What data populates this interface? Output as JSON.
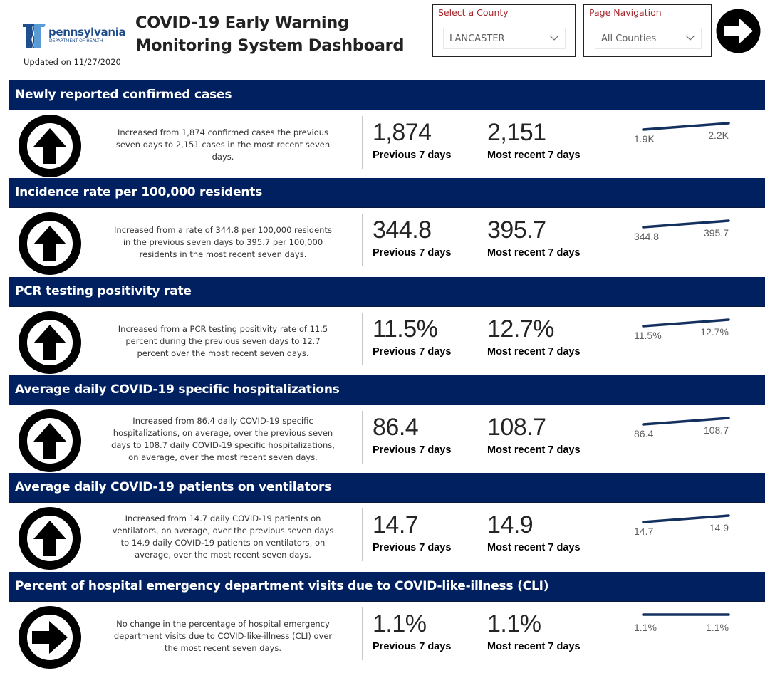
{
  "header": {
    "logo_name": "pennsylvania",
    "logo_sub": "DEPARTMENT OF HEALTH",
    "updated": "Updated on 11/27/2020",
    "title_line1": "COVID-19 Early Warning",
    "title_line2": "Monitoring System Dashboard"
  },
  "slicers": {
    "county": {
      "label": "Select a County",
      "value": "LANCASTER"
    },
    "navigation": {
      "label": "Page Navigation",
      "value": "All Counties"
    }
  },
  "nav_button": {
    "icon": "arrow-right-circle-icon"
  },
  "colors": {
    "header_bg": "#002060",
    "slicer_label": "#a4262c",
    "sparkline": "#14305e"
  },
  "sections": [
    {
      "title": "Newly reported confirmed cases",
      "trend": "up",
      "description": [
        "Increased from 1,874 confirmed cases the previous",
        "seven days to 2,151 cases in the most recent seven",
        "days."
      ],
      "previous_value": "1,874",
      "previous_label": "Previous 7 days",
      "recent_value": "2,151",
      "recent_label": "Most recent 7 days",
      "spark_start_label": "1.9K",
      "spark_end_label": "2.2K",
      "spark_values": [
        1874,
        2151
      ]
    },
    {
      "title": "Incidence rate per 100,000 residents",
      "trend": "up",
      "description": [
        "Increased from a rate of 344.8 per 100,000 residents",
        "in the previous seven days to 395.7 per 100,000",
        "residents in the most recent seven days."
      ],
      "previous_value": "344.8",
      "previous_label": "Previous 7 days",
      "recent_value": "395.7",
      "recent_label": "Most recent 7 days",
      "spark_start_label": "344.8",
      "spark_end_label": "395.7",
      "spark_values": [
        344.8,
        395.7
      ]
    },
    {
      "title": "PCR testing positivity rate",
      "trend": "up",
      "description": [
        "Increased from a PCR testing positivity rate of 11.5",
        "percent during the previous seven days to 12.7",
        "percent over the most recent seven days."
      ],
      "previous_value": "11.5%",
      "previous_label": "Previous 7 days",
      "recent_value": "12.7%",
      "recent_label": "Most recent 7 days",
      "spark_start_label": "11.5%",
      "spark_end_label": "12.7%",
      "spark_values": [
        11.5,
        12.7
      ]
    },
    {
      "title": "Average daily COVID-19 specific hospitalizations",
      "trend": "up",
      "description": [
        "Increased from 86.4 daily COVID-19 specific",
        "hospitalizations, on average, over the previous seven",
        "days to 108.7 daily COVID-19 specific hospitalizations,",
        "on average, over the most recent seven days."
      ],
      "previous_value": "86.4",
      "previous_label": "Previous 7 days",
      "recent_value": "108.7",
      "recent_label": "Most recent 7 days",
      "spark_start_label": "86.4",
      "spark_end_label": "108.7",
      "spark_values": [
        86.4,
        108.7
      ]
    },
    {
      "title": "Average daily COVID-19 patients on ventilators",
      "trend": "up",
      "description": [
        "Increased from 14.7 daily COVID-19 patients on",
        "ventilators, on average, over the previous seven days",
        "to 14.9 daily COVID-19 patients on ventilators, on",
        "average, over the most recent seven days."
      ],
      "previous_value": "14.7",
      "previous_label": "Previous 7 days",
      "recent_value": "14.9",
      "recent_label": "Most recent 7 days",
      "spark_start_label": "14.7",
      "spark_end_label": "14.9",
      "spark_values": [
        14.7,
        14.9
      ]
    },
    {
      "title": "Percent of hospital emergency department visits due to COVID-like-illness (CLI)",
      "trend": "flat",
      "description": [
        "No change in the percentage of hospital emergency",
        "department visits due to COVID-like-illness (CLI) over",
        "the most recent seven days."
      ],
      "previous_value": "1.1%",
      "previous_label": "Previous 7 days",
      "recent_value": "1.1%",
      "recent_label": "Most recent 7 days",
      "spark_start_label": "1.1%",
      "spark_end_label": "1.1%",
      "spark_values": [
        1.1,
        1.1
      ]
    }
  ]
}
